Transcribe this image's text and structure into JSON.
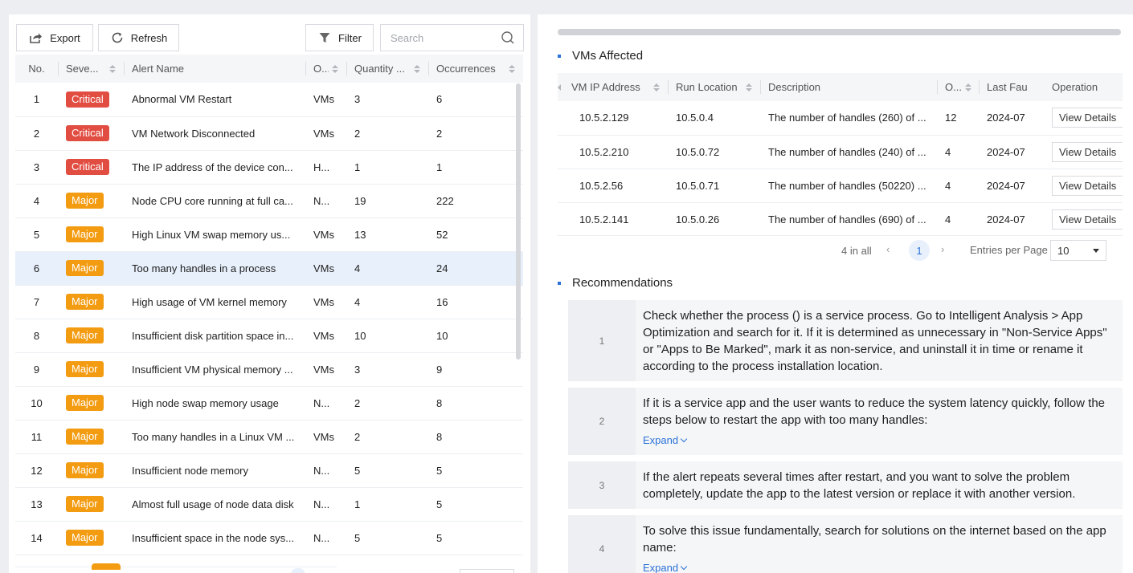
{
  "toolbar": {
    "export_label": "Export",
    "refresh_label": "Refresh",
    "filter_label": "Filter",
    "search_placeholder": "Search"
  },
  "alerts": {
    "columns": [
      "No.",
      "Seve...",
      "Alert Name",
      "O...",
      "Quantity ...",
      "Occurrences"
    ],
    "rows": [
      {
        "no": "1",
        "severity": "Critical",
        "level": "critical",
        "name": "Abnormal VM Restart",
        "object": "VMs",
        "quantity": "3",
        "occurrences": "6"
      },
      {
        "no": "2",
        "severity": "Critical",
        "level": "critical",
        "name": "VM Network Disconnected",
        "object": "VMs",
        "quantity": "2",
        "occurrences": "2"
      },
      {
        "no": "3",
        "severity": "Critical",
        "level": "critical",
        "name": "The IP address of the device con...",
        "object": "H...",
        "quantity": "1",
        "occurrences": "1"
      },
      {
        "no": "4",
        "severity": "Major",
        "level": "major",
        "name": "Node CPU core running at full ca...",
        "object": "N...",
        "quantity": "19",
        "occurrences": "222"
      },
      {
        "no": "5",
        "severity": "Major",
        "level": "major",
        "name": "High Linux VM swap memory us...",
        "object": "VMs",
        "quantity": "13",
        "occurrences": "52"
      },
      {
        "no": "6",
        "severity": "Major",
        "level": "major",
        "name": "Too many handles in a process",
        "object": "VMs",
        "quantity": "4",
        "occurrences": "24",
        "selected": true
      },
      {
        "no": "7",
        "severity": "Major",
        "level": "major",
        "name": "High usage of VM kernel memory",
        "object": "VMs",
        "quantity": "4",
        "occurrences": "16"
      },
      {
        "no": "8",
        "severity": "Major",
        "level": "major",
        "name": "Insufficient disk partition space in...",
        "object": "VMs",
        "quantity": "10",
        "occurrences": "10"
      },
      {
        "no": "9",
        "severity": "Major",
        "level": "major",
        "name": "Insufficient VM physical memory ...",
        "object": "VMs",
        "quantity": "3",
        "occurrences": "9"
      },
      {
        "no": "10",
        "severity": "Major",
        "level": "major",
        "name": "High node swap memory usage",
        "object": "N...",
        "quantity": "2",
        "occurrences": "8"
      },
      {
        "no": "11",
        "severity": "Major",
        "level": "major",
        "name": "Too many handles in a Linux VM ...",
        "object": "VMs",
        "quantity": "2",
        "occurrences": "8"
      },
      {
        "no": "12",
        "severity": "Major",
        "level": "major",
        "name": "Insufficient node memory",
        "object": "N...",
        "quantity": "5",
        "occurrences": "5"
      },
      {
        "no": "13",
        "severity": "Major",
        "level": "major",
        "name": "Almost full usage of node data disk",
        "object": "N...",
        "quantity": "1",
        "occurrences": "5"
      },
      {
        "no": "14",
        "severity": "Major",
        "level": "major",
        "name": "Insufficient space in the node sys...",
        "object": "N...",
        "quantity": "5",
        "occurrences": "5"
      }
    ]
  },
  "vms_affected": {
    "title": "VMs Affected",
    "columns": [
      "VM IP Address",
      "Run Location",
      "Description",
      "O...",
      "Last Fau",
      "Operation"
    ],
    "view_label": "View Details",
    "rows": [
      {
        "ip": "10.5.2.129",
        "location": "10.5.0.4",
        "description": "The number of handles (260) of ...",
        "count": "12",
        "last": "2024-07"
      },
      {
        "ip": "10.5.2.210",
        "location": "10.5.0.72",
        "description": "The number of handles (240) of ...",
        "count": "4",
        "last": "2024-07"
      },
      {
        "ip": "10.5.2.56",
        "location": "10.5.0.71",
        "description": "The number of handles (50220) ...",
        "count": "4",
        "last": "2024-07"
      },
      {
        "ip": "10.5.2.141",
        "location": "10.5.0.26",
        "description": "The number of handles (690) of ...",
        "count": "4",
        "last": "2024-07"
      }
    ]
  },
  "pagination": {
    "total": "4 in all",
    "page": "1",
    "entries_label": "Entries per Page",
    "page_size": "10"
  },
  "recommendations": {
    "title": "Recommendations",
    "expand_label": "Expand",
    "items": [
      {
        "num": "1",
        "text": "Check whether the process () is a service process. Go to Intelligent Analysis > App Optimization and search for it. If it is determined as unnecessary in \"Non-Service Apps\" or \"Apps to Be Marked\", mark it as non-service, and uninstall it in time or rename it according to the process installation location.",
        "expandable": false
      },
      {
        "num": "2",
        "text": "If it is a service app and the user wants to reduce the system latency quickly, follow the steps below to restart the app with too many handles:",
        "expandable": true
      },
      {
        "num": "3",
        "text": "If the alert repeats several times after restart, and you want to solve the problem completely, update the app to the latest version or replace it with another version.",
        "expandable": false
      },
      {
        "num": "4",
        "text": "To solve this issue fundamentally, search for solutions on the internet based on the app name:",
        "expandable": true
      }
    ]
  },
  "colors": {
    "critical": "#e24d42",
    "major": "#f39c12",
    "accent": "#2b72d8",
    "selected_row": "#e8f0fb"
  }
}
